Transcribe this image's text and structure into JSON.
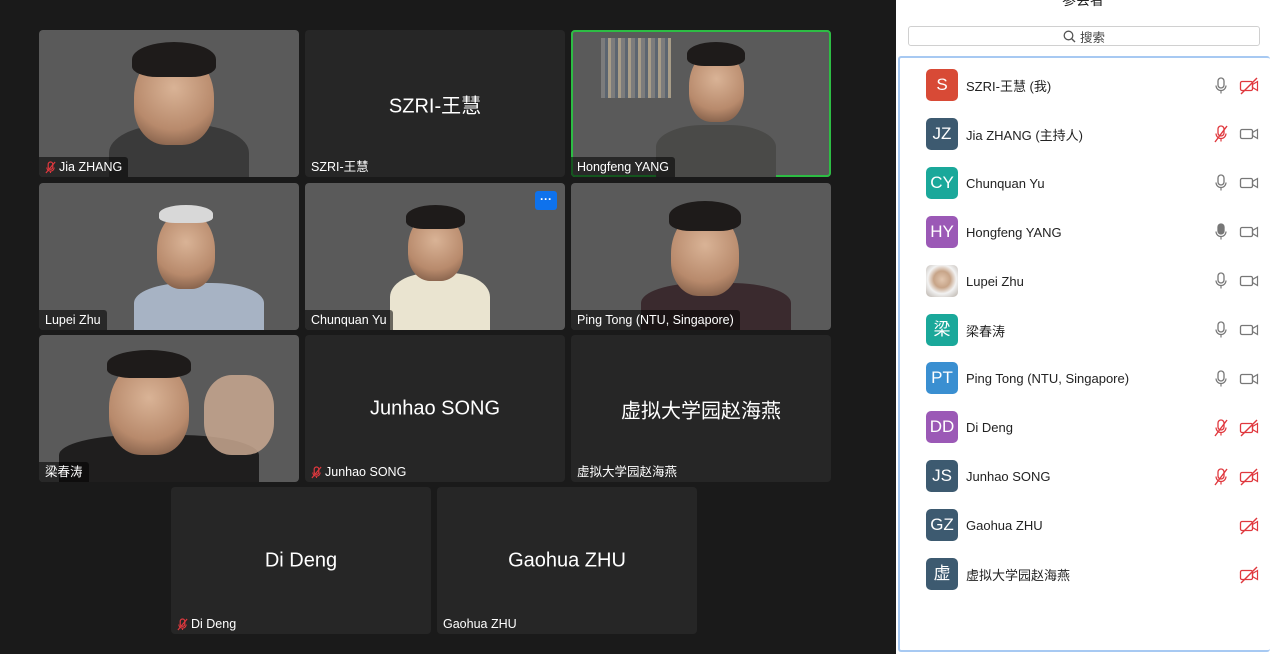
{
  "panel": {
    "title": "参会者",
    "search_placeholder": "搜索"
  },
  "tiles": [
    {
      "name": "Jia ZHANG",
      "label": "Jia ZHANG",
      "muted": true,
      "video": true
    },
    {
      "name": "SZRI-王慧",
      "label": "SZRI-王慧",
      "muted": false,
      "video": false
    },
    {
      "name": "Hongfeng YANG",
      "label": "Hongfeng YANG",
      "muted": false,
      "video": true,
      "active_speaker": true
    },
    {
      "name": "Lupei Zhu",
      "label": "Lupei Zhu",
      "muted": false,
      "video": true
    },
    {
      "name": "Chunquan Yu",
      "label": "Chunquan Yu",
      "muted": false,
      "video": true,
      "menu_label": "···"
    },
    {
      "name": "Ping Tong (NTU, Singapore)",
      "label": "Ping Tong (NTU, Singapore)",
      "muted": false,
      "video": true
    },
    {
      "name": "梁春涛",
      "label": "梁春涛",
      "muted": false,
      "video": true
    },
    {
      "name": "Junhao SONG",
      "label": "Junhao SONG",
      "muted": true,
      "video": false
    },
    {
      "name": "虚拟大学园赵海燕",
      "label": "虚拟大学园赵海燕",
      "muted": false,
      "video": false
    },
    {
      "name": "Di Deng",
      "label": "Di Deng",
      "muted": true,
      "video": false
    },
    {
      "name": "Gaohua ZHU",
      "label": "Gaohua ZHU",
      "muted": false,
      "video": false
    }
  ],
  "participants": [
    {
      "initials": "S",
      "name": "SZRI-王慧 (我)",
      "color": "#d84a36",
      "mic": "on",
      "cam": "off"
    },
    {
      "initials": "JZ",
      "name": "Jia ZHANG (主持人)",
      "color": "#3d5a70",
      "mic": "off",
      "cam": "on"
    },
    {
      "initials": "CY",
      "name": "Chunquan Yu",
      "color": "#1aa89a",
      "mic": "on",
      "cam": "on"
    },
    {
      "initials": "HY",
      "name": "Hongfeng YANG",
      "color": "#9b59b6",
      "mic": "speaking",
      "cam": "on"
    },
    {
      "initials": "",
      "name": "Lupei Zhu",
      "color": "#c8c0b5",
      "mic": "on",
      "cam": "on",
      "photo": true
    },
    {
      "initials": "梁",
      "name": "梁春涛",
      "color": "#1aa89a",
      "mic": "on",
      "cam": "on"
    },
    {
      "initials": "PT",
      "name": "Ping Tong (NTU, Singapore)",
      "color": "#3a8fd1",
      "mic": "on",
      "cam": "on"
    },
    {
      "initials": "DD",
      "name": "Di Deng",
      "color": "#9b59b6",
      "mic": "off",
      "cam": "off"
    },
    {
      "initials": "JS",
      "name": "Junhao SONG",
      "color": "#3d5a70",
      "mic": "off",
      "cam": "off"
    },
    {
      "initials": "GZ",
      "name": "Gaohua ZHU",
      "color": "#3d5a70",
      "mic": "none",
      "cam": "off"
    },
    {
      "initials": "虚",
      "name": "虚拟大学园赵海燕",
      "color": "#3d5a70",
      "mic": "none",
      "cam": "off"
    }
  ],
  "colors": {
    "muted_red": "#e0383e",
    "active_speaker_green": "#2dbd44",
    "menu_blue": "#0e72ed",
    "icon_gray": "#777777"
  }
}
